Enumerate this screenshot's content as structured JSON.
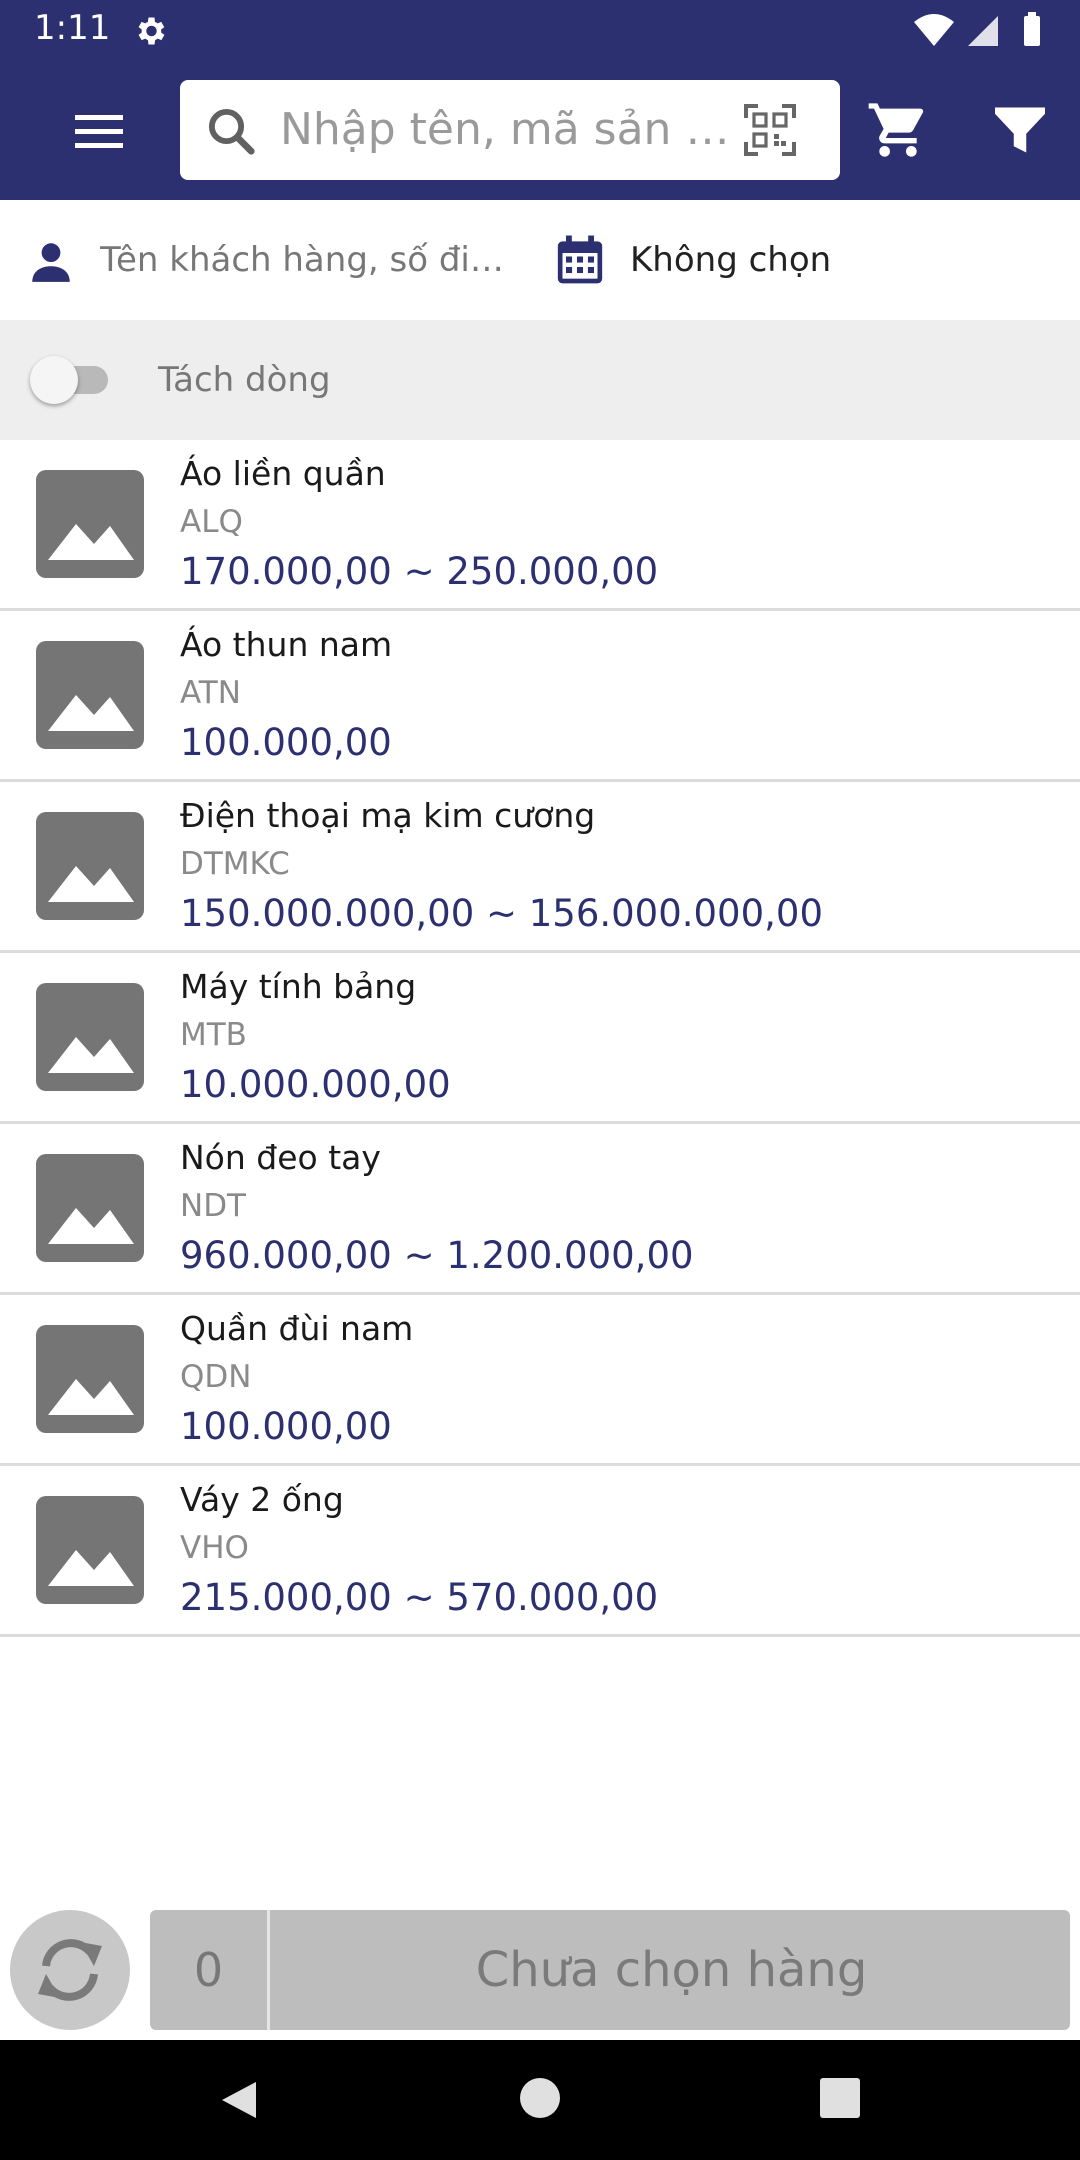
{
  "status_bar": {
    "time": "1:11"
  },
  "appbar": {
    "search_placeholder": "Nhập tên, mã sản phẩm"
  },
  "filters": {
    "customer_placeholder": "Tên khách hàng, số điện thoại",
    "date_value": "Không chọn"
  },
  "toggle": {
    "label": "Tách dòng",
    "checked": false
  },
  "products": [
    {
      "name": "Áo liền quần",
      "code": "ALQ",
      "price": "170.000,00 ~ 250.000,00"
    },
    {
      "name": "Áo thun nam",
      "code": "ATN",
      "price": "100.000,00"
    },
    {
      "name": "Điện thoại mạ kim cương",
      "code": "DTMKC",
      "price": "150.000.000,00 ~ 156.000.000,00"
    },
    {
      "name": "Máy tính bảng",
      "code": "MTB",
      "price": "10.000.000,00"
    },
    {
      "name": "Nón đeo tay",
      "code": "NDT",
      "price": "960.000,00 ~ 1.200.000,00"
    },
    {
      "name": "Quần đùi nam",
      "code": "QDN",
      "price": "100.000,00"
    },
    {
      "name": "Váy 2 ống",
      "code": "VHO",
      "price": "215.000,00 ~ 570.000,00"
    }
  ],
  "bottom": {
    "count": "0",
    "status": "Chưa chọn hàng"
  },
  "colors": {
    "primary": "#2c3070",
    "price": "#2c3070",
    "thumb": "#757575",
    "toggle_bg": "#eeeeee"
  },
  "icons": [
    "settings-icon",
    "wifi-icon",
    "signal-icon",
    "battery-icon",
    "menu-icon",
    "search-icon",
    "qr-code-icon",
    "cart-icon",
    "filter-icon",
    "person-icon",
    "calendar-icon",
    "image-placeholder-icon",
    "refresh-icon",
    "back-icon",
    "home-icon",
    "recents-icon"
  ]
}
